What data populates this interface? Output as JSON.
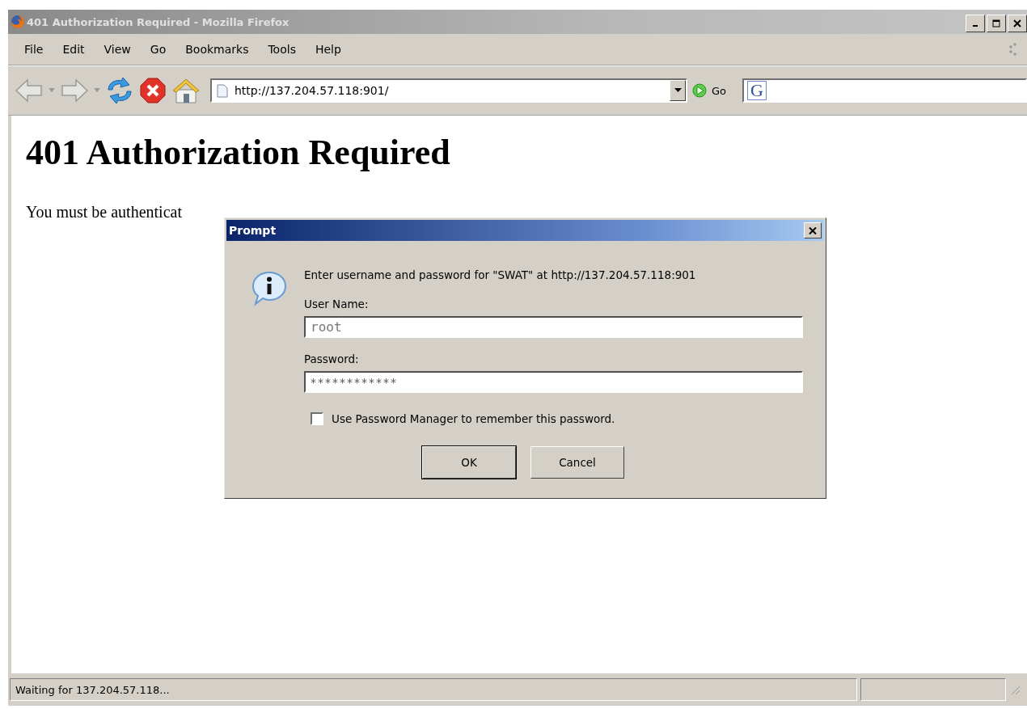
{
  "window": {
    "title": "401 Authorization Required - Mozilla Firefox"
  },
  "menu": [
    "File",
    "Edit",
    "View",
    "Go",
    "Bookmarks",
    "Tools",
    "Help"
  ],
  "toolbar": {
    "address": "http://137.204.57.118:901/",
    "go_label": "Go",
    "search_logo": "G"
  },
  "page": {
    "heading": "401 Authorization Required",
    "text": "You must be authenticat"
  },
  "dialog": {
    "title": "Prompt",
    "message": "Enter username and password for \"SWAT\" at http://137.204.57.118:901",
    "fields": [
      {
        "kind": "text",
        "label": "User Name:",
        "value": "root"
      },
      {
        "kind": "password",
        "label": "Password:",
        "value": "************"
      }
    ],
    "checkbox": {
      "label": "Use Password Manager to remember this password.",
      "checked": false
    },
    "buttons": [
      "OK",
      "Cancel"
    ]
  },
  "status_bar": {
    "text": "Waiting for 137.204.57.118..."
  }
}
